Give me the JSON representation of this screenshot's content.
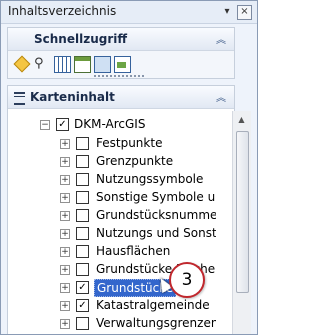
{
  "window": {
    "title": "Inhaltsverzeichnis",
    "pin_icon": "pin-icon",
    "close_label": "×"
  },
  "quick_access": {
    "title": "Schnellzugriff",
    "collapse_icon": "chevron-up-icon",
    "tools": [
      "diamond-tool-icon",
      "binoculars-icon",
      "table-icon",
      "edit-window-icon",
      "layout-window-icon",
      "map-window-icon"
    ]
  },
  "map_content": {
    "title": "Karteninhalt",
    "collapse_icon": "chevron-up-icon",
    "root": {
      "label": "DKM-ArcGIS",
      "checked": true,
      "expander": "−"
    },
    "layers": [
      {
        "label": "Festpunkte",
        "checked": false,
        "expander": "+"
      },
      {
        "label": "Grenzpunkte",
        "checked": false,
        "expander": "+"
      },
      {
        "label": "Nutzungssymbole",
        "checked": false,
        "expander": "+"
      },
      {
        "label": "Sonstige Symbole und",
        "checked": false,
        "expander": "+"
      },
      {
        "label": "Grundstücksnummern",
        "checked": false,
        "expander": "+"
      },
      {
        "label": "Nutzungs und Sonstige",
        "checked": false,
        "expander": "+"
      },
      {
        "label": "Hausflächen",
        "checked": false,
        "expander": "+"
      },
      {
        "label": "Grundstücke Fläche",
        "checked": false,
        "expander": "+"
      },
      {
        "label": "Grundstücke",
        "checked": true,
        "expander": "+",
        "selected": true
      },
      {
        "label": "Katastralgemeinde",
        "checked": true,
        "expander": "+"
      },
      {
        "label": "Verwaltungsgrenzen",
        "checked": false,
        "expander": "+"
      }
    ]
  },
  "callout": {
    "number": "3"
  },
  "checkmark": "✓"
}
